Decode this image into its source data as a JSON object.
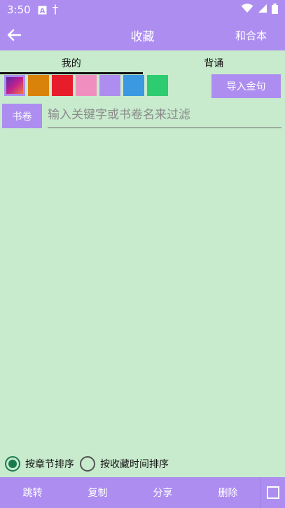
{
  "status": {
    "time": "3:50",
    "icon1": "A",
    "icon2": "†"
  },
  "appbar": {
    "title": "收藏",
    "action": "和合本"
  },
  "tabs": [
    {
      "label": "我的"
    },
    {
      "label": "背诵"
    }
  ],
  "colors": {
    "accent": "#ad8ef0",
    "background": "#c8ebcd",
    "swatches": [
      "gradient-purple-red",
      "#d9830a",
      "#e81d2c",
      "#f08fbf",
      "#ad8ef0",
      "#3a99e0",
      "#2ecc71"
    ]
  },
  "toolbar": {
    "import_label": "导入金句",
    "book_label": "书卷"
  },
  "search": {
    "placeholder": "输入关键字或书卷名来过滤",
    "value": ""
  },
  "sort": {
    "option1": "按章节排序",
    "option2": "按收藏时间排序",
    "selected": "option1"
  },
  "bottombar": {
    "jump": "跳转",
    "copy": "复制",
    "share": "分享",
    "delete": "删除"
  }
}
